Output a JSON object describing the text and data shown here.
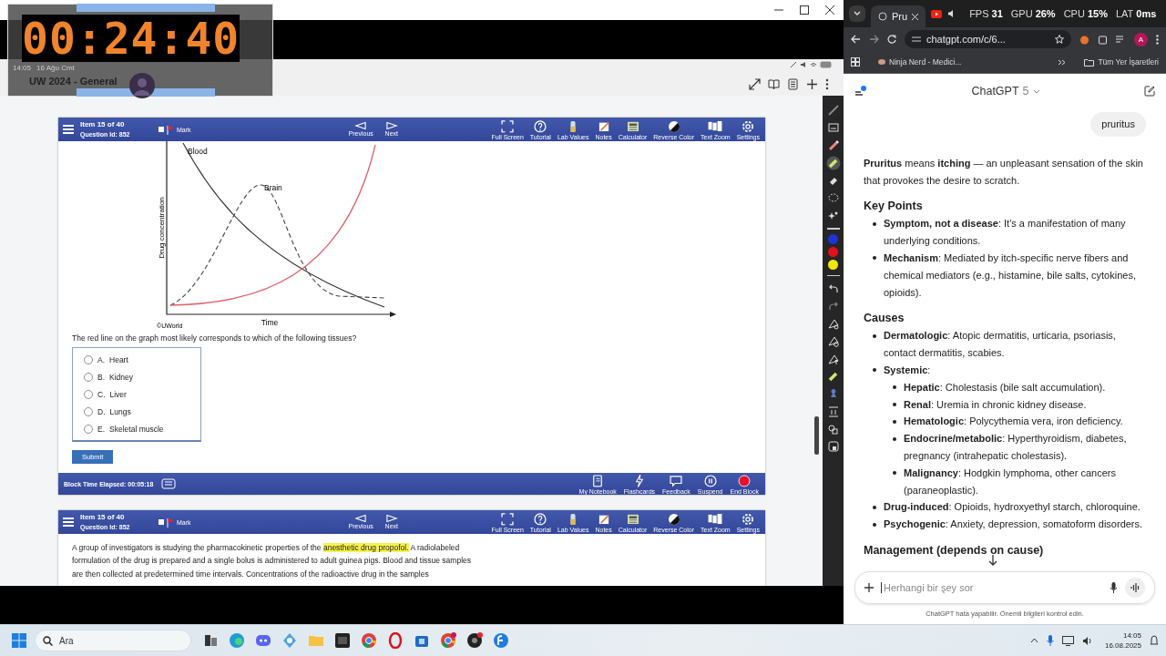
{
  "screen_recorder": {
    "timer": "00:24:40",
    "clock": "14:05",
    "date": "16 Ağu Cmt",
    "tab_title": "UW 2024 - General"
  },
  "question_panel": {
    "item": "Item 15 of 40",
    "question_id": "Question Id: 852",
    "mark": {
      "label": "Mark",
      "checked": false
    },
    "nav": [
      "Previous",
      "Next"
    ],
    "tools": [
      "Full Screen",
      "Tutorial",
      "Lab Values",
      "Notes",
      "Calculator",
      "Reverse Color",
      "Text Zoom",
      "Settings"
    ],
    "figure": {
      "curve_labels": [
        "Blood",
        "Brain"
      ],
      "ylabel": "Drug concentration",
      "xlabel": "Time",
      "credit": "©UWorld"
    },
    "question": "The red line on the graph most likely corresponds to which of the following tissues?",
    "options": [
      {
        "letter": "A.",
        "text": "Heart",
        "selected": false
      },
      {
        "letter": "B.",
        "text": "Kidney",
        "selected": false
      },
      {
        "letter": "C.",
        "text": "Liver",
        "selected": false
      },
      {
        "letter": "D.",
        "text": "Lungs",
        "selected": false
      },
      {
        "letter": "E.",
        "text": "Skeletal muscle",
        "selected": false
      }
    ],
    "submit": "Submit",
    "footer": {
      "elapsed": "Block Time Elapsed: 00:05:18",
      "actions": [
        "My Notebook",
        "Flashcards",
        "Feedback",
        "Suspend",
        "End Block"
      ]
    }
  },
  "second_panel": {
    "item": "Item 15 of 40",
    "question_id": "Question Id: 852",
    "mark": {
      "label": "Mark",
      "checked": false
    },
    "nav": [
      "Previous",
      "Next"
    ],
    "tools": [
      "Full Screen",
      "Tutorial",
      "Lab Values",
      "Notes",
      "Calculator",
      "Reverse Color",
      "Text Zoom",
      "Settings"
    ],
    "passage": {
      "before": "A group of investigators is studying the pharmacokinetic properties of the ",
      "highlight": "anesthetic drug propofol.",
      "after": "  A radiolabeled formulation of the drug is prepared and a single bolus is administered to adult guinea pigs.  Blood and tissue samples are then collected at predetermined time intervals.  Concentrations of the radioactive drug in the samples"
    }
  },
  "pen_toolbar": {
    "colors": [
      {
        "color": "#1c34d6"
      },
      {
        "color": "#e0101c"
      },
      {
        "color": "#f2e70f"
      }
    ]
  },
  "browser": {
    "tab": "Pru",
    "perf": [
      {
        "label": "FPS",
        "value": "31"
      },
      {
        "label": "GPU",
        "value": "26%"
      },
      {
        "label": "CPU",
        "value": "15%"
      },
      {
        "label": "LAT",
        "value": "0ms"
      }
    ],
    "address": "chatgpt.com/c/6...",
    "profile": "A",
    "bookmark": "Ninja Nerd - Medici...",
    "all_bookmarks": "Tüm Yer İşaretleri"
  },
  "chat": {
    "model": "ChatGPT",
    "version": "5",
    "user_message": "pruritus",
    "response": [
      {
        "kind": "paragraph",
        "text": "**Pruritus** means **itching** — an unpleasant sensation of the skin that provokes the desire to scratch."
      },
      {
        "kind": "heading",
        "text": "Key Points"
      },
      {
        "kind": "list",
        "items": [
          {
            "text": "**Symptom, not a disease**: It's a manifestation of many underlying conditions."
          },
          {
            "text": "**Mechanism**: Mediated by itch-specific nerve fibers and chemical mediators (e.g., histamine, bile salts, cytokines, opioids)."
          }
        ]
      },
      {
        "kind": "heading",
        "text": "Causes"
      },
      {
        "kind": "list",
        "items": [
          {
            "text": "**Dermatologic**: Atopic dermatitis, urticaria, psoriasis, contact dermatitis, scabies."
          },
          {
            "text": "**Systemic**:",
            "children": [
              {
                "text": "**Hepatic**: Cholestasis (bile salt accumulation)."
              },
              {
                "text": "**Renal**: Uremia in chronic kidney disease."
              },
              {
                "text": "**Hematologic**: Polycythemia vera, iron deficiency."
              },
              {
                "text": "**Endocrine/metabolic**: Hyperthyroidism, diabetes, pregnancy (intrahepatic cholestasis)."
              },
              {
                "text": "**Malignancy**: Hodgkin lymphoma, other cancers (paraneoplastic)."
              }
            ]
          },
          {
            "text": "**Drug-induced**: Opioids, hydroxyethyl starch, chloroquine."
          },
          {
            "text": "**Psychogenic**: Anxiety, depression, somatoform disorders."
          }
        ]
      },
      {
        "kind": "heading",
        "text": "Management (depends on cause)"
      }
    ],
    "input_placeholder": "Herhangi bir şey sor",
    "disclaimer": "ChatGPT hata yapabilir. Önemli bilgileri kontrol edin."
  },
  "taskbar": {
    "search": "Ara",
    "time": "14:05",
    "date": "16.08.2025"
  }
}
